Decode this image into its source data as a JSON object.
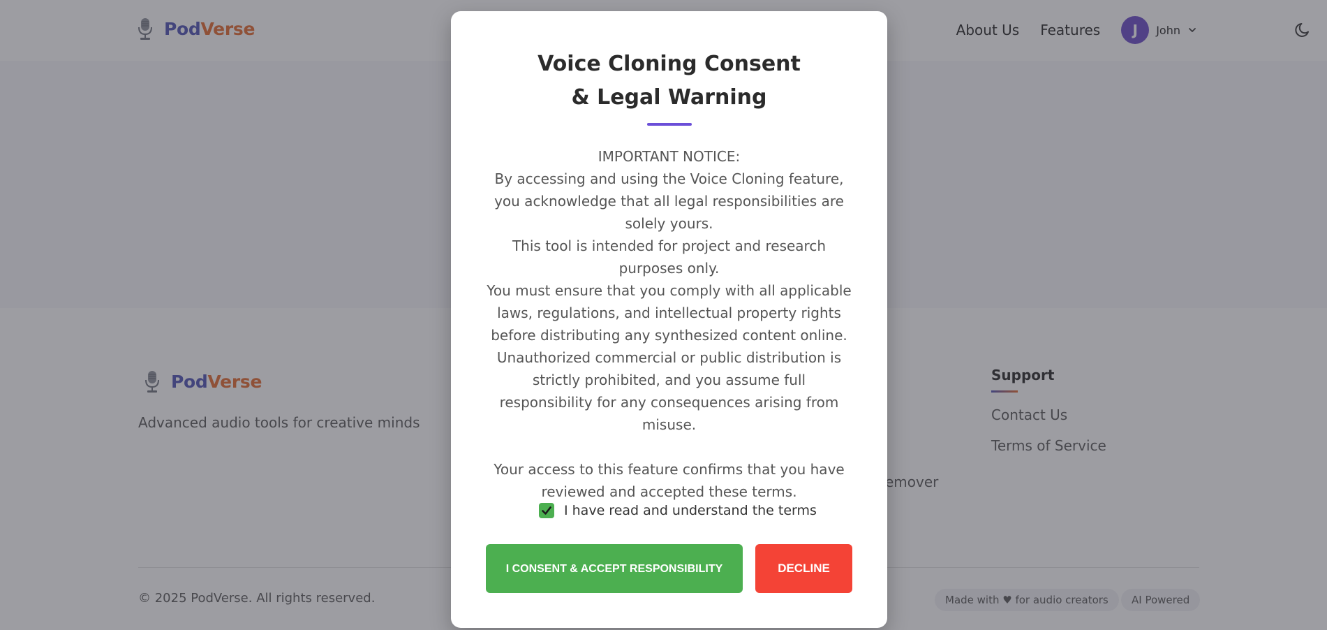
{
  "header": {
    "logo": {
      "part1": "Pod",
      "part2": "Verse",
      "icon": "microphone-icon"
    },
    "nav": [
      {
        "label": "About Us"
      },
      {
        "label": "Features"
      }
    ],
    "user": {
      "initial": "J",
      "name": "John"
    },
    "theme_icon": "moon-icon"
  },
  "footer": {
    "logo": {
      "part1": "Pod",
      "part2": "Verse"
    },
    "tagline": "Advanced audio tools for creative minds",
    "support": {
      "title": "Support",
      "links": [
        "Contact Us",
        "Terms of Service"
      ]
    },
    "partial_link": "Remover",
    "copyright": "© 2025 PodVerse. All rights reserved.",
    "badges": [
      "Made with ♥ for audio creators",
      "AI Powered"
    ]
  },
  "modal": {
    "title_line1": "Voice Cloning Consent",
    "title_line2": "& Legal Warning",
    "notice": [
      "IMPORTANT NOTICE:",
      "By accessing and using the Voice Cloning feature, you acknowledge that all legal responsibilities are solely yours.",
      "This tool is intended for project and research purposes only.",
      "You must ensure that you comply with all applicable laws, regulations, and intellectual property rights before distributing any synthesized content online.",
      "Unauthorized commercial or public distribution is strictly prohibited, and you assume full responsibility for any consequences arising from misuse."
    ],
    "confirmation": "Your access to this feature confirms that you have reviewed and accepted these terms.",
    "checkbox_label": "I have read and understand the terms",
    "checkbox_checked": true,
    "accept_label": "I Consent & Accept Responsibility",
    "decline_label": "Decline"
  },
  "colors": {
    "brand_blue": "#4a4fb3",
    "brand_orange": "#e2662a",
    "accent_purple": "#6b4fd8",
    "accept_green": "#4caf50",
    "decline_red": "#f44336"
  }
}
